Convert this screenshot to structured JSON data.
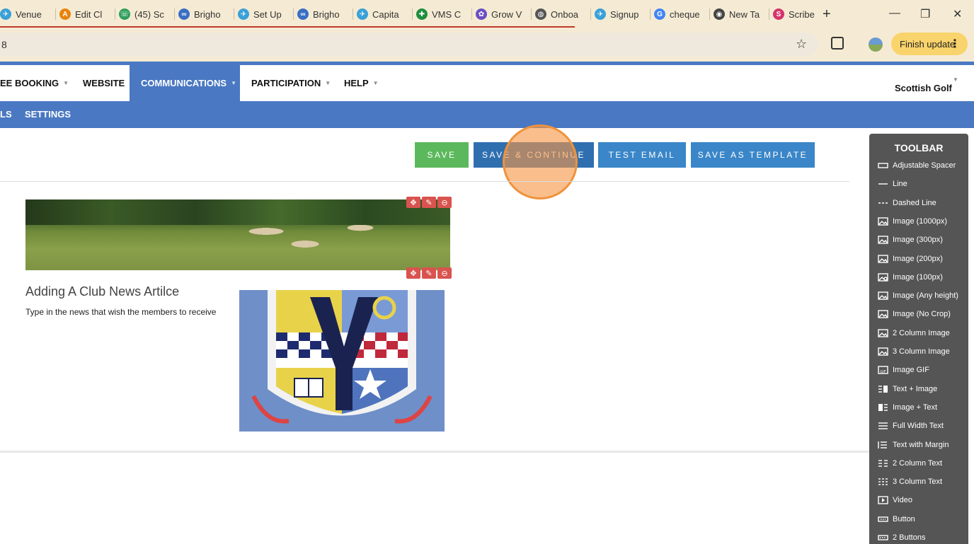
{
  "browser": {
    "tabs": [
      {
        "label": "Venue",
        "icon": "scribe-icon",
        "color": "#3aa0d8"
      },
      {
        "label": "Edit Cl",
        "icon": "a-logo-icon",
        "color": "#e8830c"
      },
      {
        "label": "(45) Sc",
        "icon": "chat-icon",
        "color": "#2e9e5b"
      },
      {
        "label": "Brigho",
        "icon": "link-icon",
        "color": "#3a6fc4"
      },
      {
        "label": "Set Up",
        "icon": "scribe-icon",
        "color": "#3aa0d8"
      },
      {
        "label": "Brigho",
        "icon": "link-icon",
        "color": "#3a6fc4"
      },
      {
        "label": "Capita",
        "icon": "scribe-icon",
        "color": "#3aa0d8"
      },
      {
        "label": "VMS C",
        "icon": "sheets-icon",
        "color": "#1e8e3e"
      },
      {
        "label": "Grow V",
        "icon": "flower-icon",
        "color": "#6a4fc2"
      },
      {
        "label": "Onboa",
        "icon": "globe-icon",
        "color": "#555555"
      },
      {
        "label": "Signup",
        "icon": "scribe-icon",
        "color": "#3aa0d8"
      },
      {
        "label": "cheque",
        "icon": "google-icon",
        "color": "#4285f4"
      },
      {
        "label": "New Ta",
        "icon": "chrome-icon",
        "color": "#444444"
      },
      {
        "label": "Scribe",
        "icon": "scribe-logo-icon",
        "color": "#d6336c"
      }
    ],
    "address": "8",
    "finish_update": "Finish update"
  },
  "nav": {
    "items": [
      {
        "label": "EE BOOKING",
        "caret": true
      },
      {
        "label": "WEBSITE",
        "caret": false
      },
      {
        "label": "COMMUNICATIONS",
        "caret": true,
        "active": true
      },
      {
        "label": "PARTICIPATION",
        "caret": true
      },
      {
        "label": "HELP",
        "caret": true
      }
    ],
    "account": "Scottish Golf"
  },
  "subnav": {
    "items": [
      "LS",
      "SETTINGS"
    ]
  },
  "actions": {
    "save": "SAVE",
    "save_continue": "SAVE & CONTINUE",
    "test_email": "TEST EMAIL",
    "save_template": "SAVE AS TEMPLATE"
  },
  "article": {
    "title": "Adding A Club News Artilce",
    "body": "Type in the news that wish the members to receive"
  },
  "toolbar": {
    "title": "TOOLBAR",
    "items": [
      {
        "label": "Adjustable Spacer",
        "icon": "spacer-icon"
      },
      {
        "label": "Line",
        "icon": "line-icon"
      },
      {
        "label": "Dashed Line",
        "icon": "dashed-line-icon"
      },
      {
        "label": "Image (1000px)",
        "icon": "image-icon"
      },
      {
        "label": "Image (300px)",
        "icon": "image-icon"
      },
      {
        "label": "Image (200px)",
        "icon": "image-icon"
      },
      {
        "label": "Image (100px)",
        "icon": "image-small-icon"
      },
      {
        "label": "Image (Any height)",
        "icon": "image-icon"
      },
      {
        "label": "Image (No Crop)",
        "icon": "image-icon"
      },
      {
        "label": "2 Column Image",
        "icon": "image-icon"
      },
      {
        "label": "3 Column Image",
        "icon": "image-icon"
      },
      {
        "label": "Image GIF",
        "icon": "gif-icon"
      },
      {
        "label": "Text + Image",
        "icon": "text-image-icon"
      },
      {
        "label": "Image + Text",
        "icon": "image-text-icon"
      },
      {
        "label": "Full Width Text",
        "icon": "full-text-icon"
      },
      {
        "label": "Text with Margin",
        "icon": "margin-text-icon"
      },
      {
        "label": "2 Column Text",
        "icon": "two-col-text-icon"
      },
      {
        "label": "3 Column Text",
        "icon": "three-col-text-icon"
      },
      {
        "label": "Video",
        "icon": "video-icon"
      },
      {
        "label": "Button",
        "icon": "button-icon"
      },
      {
        "label": "2 Buttons",
        "icon": "two-buttons-icon"
      }
    ]
  }
}
